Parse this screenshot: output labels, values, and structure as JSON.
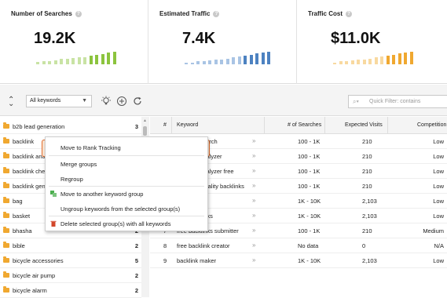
{
  "stats": [
    {
      "title": "Number of Searches",
      "value": "19.2K",
      "bars": [
        2,
        3,
        3,
        4,
        5,
        5,
        6,
        7,
        7,
        8,
        9,
        10,
        11,
        12
      ],
      "bar_color": "#8cc43e",
      "bar_color_light": "#c9e3a4"
    },
    {
      "title": "Estimated Traffic",
      "value": "7.4K",
      "bars": [
        2,
        2,
        3,
        3,
        4,
        5,
        5,
        6,
        7,
        8,
        9,
        10,
        11,
        12,
        13
      ],
      "bar_color": "#4d82c1",
      "bar_color_light": "#a9c4e4"
    },
    {
      "title": "Traffic Cost",
      "value": "$11.0K",
      "bars": [
        2,
        3,
        3,
        4,
        5,
        5,
        6,
        7,
        8,
        9,
        10,
        11,
        12,
        13
      ],
      "bar_color": "#f0a830",
      "bar_color_light": "#f8d9a0"
    }
  ],
  "toolbar": {
    "group_select": "All keywords",
    "quick_filter_placeholder": "Quick Filter: contains"
  },
  "groups": [
    {
      "name": "b2b lead generation",
      "count": "3"
    },
    {
      "name": "backlink",
      "count": ""
    },
    {
      "name": "backlink ana",
      "count": ""
    },
    {
      "name": "backlink che",
      "count": ""
    },
    {
      "name": "backlink gen",
      "count": ""
    },
    {
      "name": "bag",
      "count": ""
    },
    {
      "name": "basket",
      "count": ""
    },
    {
      "name": "bhasha",
      "count": "2"
    },
    {
      "name": "bible",
      "count": "2"
    },
    {
      "name": "bicycle accessories",
      "count": "5"
    },
    {
      "name": "bicycle air pump",
      "count": "2"
    },
    {
      "name": "bicycle alarm",
      "count": "2"
    }
  ],
  "table": {
    "columns": [
      "#",
      "Keyword",
      "# of Searches",
      "Expected Visits",
      "Competition"
    ],
    "rows": [
      {
        "num": "",
        "keyword": "backlink search",
        "searches": "100 - 1K",
        "visits": "210",
        "competition": "Low"
      },
      {
        "num": "",
        "keyword": "backlink analyzer",
        "searches": "100 - 1K",
        "visits": "210",
        "competition": "Low"
      },
      {
        "num": "",
        "keyword": "backlink analyzer free",
        "searches": "100 - 1K",
        "visits": "210",
        "competition": "Low"
      },
      {
        "num": "",
        "keyword": "free high quality backlinks",
        "searches": "100 - 1K",
        "visits": "210",
        "competition": "Low"
      },
      {
        "num": "",
        "keyword": "backlinks",
        "searches": "1K - 10K",
        "visits": "2,103",
        "competition": "Low"
      },
      {
        "num": "",
        "keyword": "free backlinks",
        "searches": "1K - 10K",
        "visits": "2,103",
        "competition": "Low"
      },
      {
        "num": "7",
        "keyword": "free backlinks submitter",
        "searches": "100 - 1K",
        "visits": "210",
        "competition": "Medium"
      },
      {
        "num": "8",
        "keyword": "free backlink creator",
        "searches": "No data",
        "visits": "0",
        "competition": "N/A"
      },
      {
        "num": "9",
        "keyword": "backlink maker",
        "searches": "1K - 10K",
        "visits": "2,103",
        "competition": "Low"
      }
    ]
  },
  "context_menu": {
    "items": [
      {
        "label": "Move to Rank Tracking",
        "icon": ""
      },
      {
        "label": "Merge groups",
        "icon": ""
      },
      {
        "label": "Regroup",
        "icon": ""
      },
      {
        "label": "Move to another keyword group",
        "icon": "move-group-icon"
      },
      {
        "label": "Ungroup keywords from the selected group(s)",
        "icon": ""
      },
      {
        "label": "Delete selected group(s) with all keywords",
        "icon": "trash-icon"
      }
    ]
  }
}
